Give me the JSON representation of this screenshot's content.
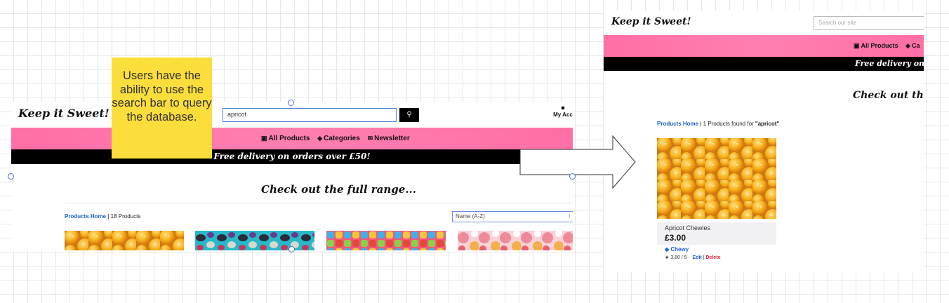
{
  "left_screen": {
    "brand": "Keep it Sweet!",
    "search": {
      "value": "apricot"
    },
    "account_label": "My Acc",
    "nav": [
      "All Products",
      "Categories",
      "Newsletter"
    ],
    "banner": "Free delivery on orders over £50!",
    "heading": "Check out the full range...",
    "breadcrumb_link": "Products Home",
    "breadcrumb_text": " | 18 Products",
    "sort_value": "Name (A-Z)",
    "colors": {
      "pink": "#ff7aab",
      "banner": "#000000",
      "link": "#1a5fd0"
    }
  },
  "right_screen": {
    "brand": "Keep it Sweet!",
    "search": {
      "placeholder": "Search our site"
    },
    "nav": [
      "All Products",
      "Ca"
    ],
    "banner": "Free delivery on ord",
    "heading": "Check out the f",
    "breadcrumb_link": "Products Home",
    "breadcrumb_text": " | 1 Products found for ",
    "query": "\"apricot\"",
    "product": {
      "name": "Apricot Chewies",
      "price": "£3.00",
      "category": "Chewy",
      "rating": "3.80 / 5",
      "edit": "Edit",
      "delete": "Delete"
    }
  },
  "annotation": {
    "text": "Users have the ability to use the search bar to query the database."
  }
}
